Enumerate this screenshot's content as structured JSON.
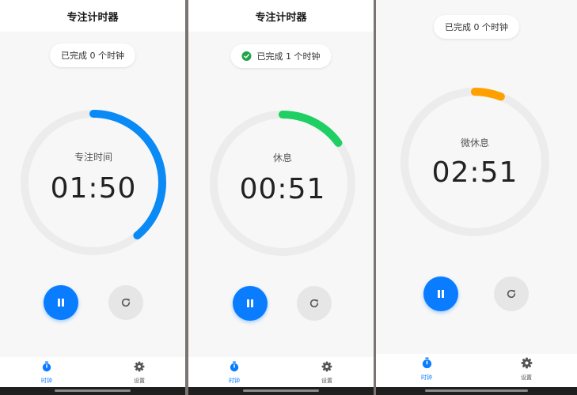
{
  "screens": [
    {
      "title": "专注计时器",
      "completed_badge": "已完成 0 个时钟",
      "phase_label": "专注时间",
      "time": "01:50",
      "progress": 0.39,
      "ring_color": "#0a8af5",
      "nav": [
        {
          "label": "时钟",
          "icon": "timer-icon",
          "active": true
        },
        {
          "label": "设置",
          "icon": "gear-icon",
          "active": false
        }
      ]
    },
    {
      "title": "专注计时器",
      "completed_badge": "已完成 1 个时钟",
      "phase_label": "休息",
      "time": "00:51",
      "progress": 0.15,
      "ring_color": "#1fcf63",
      "nav": [
        {
          "label": "时钟",
          "icon": "timer-icon",
          "active": true
        },
        {
          "label": "设置",
          "icon": "gear-icon",
          "active": false
        }
      ]
    },
    {
      "completed_badge": "已完成 0 个时钟",
      "phase_label": "微休息",
      "time": "02:51",
      "progress": 0.06,
      "ring_color": "#ffa000",
      "nav": [
        {
          "label": "时钟",
          "icon": "timer-icon",
          "active": true
        },
        {
          "label": "设置",
          "icon": "gear-icon",
          "active": false
        }
      ]
    }
  ],
  "colors": {
    "accent": "#0a7cff",
    "ring_track": "#ececec",
    "success": "#22a34a",
    "background": "#f7f7f7"
  }
}
